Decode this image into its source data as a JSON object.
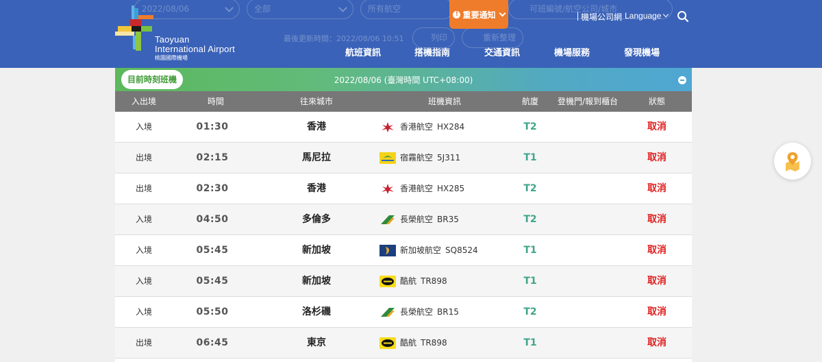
{
  "header": {
    "ghost_filters": {
      "date": "2022/08/06",
      "terminal": "全部",
      "airline": "所有航空",
      "search_hint": "可班編號/航空公司/城市",
      "updated": "最後更新時間：2022/08/06 10:51",
      "print": "列印",
      "refresh": "重新整理"
    },
    "logo": {
      "line1": "Taoyuan",
      "line2": "International Airport",
      "line3": "桃園國際機場"
    },
    "notice": {
      "label": "重要通知",
      "icon": "alert-icon"
    },
    "airline_link": "機場公司網",
    "language": "Language",
    "search_icon": "search-icon",
    "nav": [
      "航班資訊",
      "搭機指南",
      "交通資訊",
      "機場服務",
      "發現機場"
    ]
  },
  "panel": {
    "tab_label": "目前時刻班機",
    "date_label": "2022/08/06 (臺灣時間 UTC+08:00)",
    "collapse_icon": "minus-circle-icon",
    "columns": [
      "入出境",
      "時間",
      "往來城市",
      "班機資訊",
      "航廈",
      "登機門/報到櫃台",
      "狀態"
    ],
    "rows": [
      {
        "dir": "入境",
        "time": "01:30",
        "city": "香港",
        "airline": "香港航空",
        "flight": "HX284",
        "logo": "hk-airlines-logo",
        "terminal": "T2",
        "status": "取消"
      },
      {
        "dir": "出境",
        "time": "02:15",
        "city": "馬尼拉",
        "airline": "宿霧航空",
        "flight": "5J311",
        "logo": "cebu-pacific-logo",
        "terminal": "T1",
        "status": "取消"
      },
      {
        "dir": "出境",
        "time": "02:30",
        "city": "香港",
        "airline": "香港航空",
        "flight": "HX285",
        "logo": "hk-airlines-logo",
        "terminal": "T2",
        "status": "取消"
      },
      {
        "dir": "入境",
        "time": "04:50",
        "city": "多倫多",
        "airline": "長榮航空",
        "flight": "BR35",
        "logo": "eva-air-logo",
        "terminal": "T2",
        "status": "取消"
      },
      {
        "dir": "入境",
        "time": "05:45",
        "city": "新加坡",
        "airline": "新加坡航空",
        "flight": "SQ8524",
        "logo": "singapore-airlines-logo",
        "terminal": "T1",
        "status": "取消"
      },
      {
        "dir": "入境",
        "time": "05:45",
        "city": "新加坡",
        "airline": "酷航",
        "flight": "TR898",
        "logo": "scoot-logo",
        "terminal": "T1",
        "status": "取消"
      },
      {
        "dir": "入境",
        "time": "05:50",
        "city": "洛杉磯",
        "airline": "長榮航空",
        "flight": "BR15",
        "logo": "eva-air-logo",
        "terminal": "T2",
        "status": "取消"
      },
      {
        "dir": "出境",
        "time": "06:45",
        "city": "東京",
        "airline": "酷航",
        "flight": "TR898",
        "logo": "scoot-logo",
        "terminal": "T1",
        "status": "取消"
      }
    ]
  },
  "fab": {
    "icon": "map-pin-icon"
  },
  "colors": {
    "header_bg": "#3a62b8",
    "notice_bg": "#ef7c2a",
    "banner_green": "#5cb85c",
    "banner_blue": "#4fa7d3",
    "table_head": "#777777",
    "terminal_text": "#3fa58b",
    "status_cancel": "#e01e1e"
  }
}
